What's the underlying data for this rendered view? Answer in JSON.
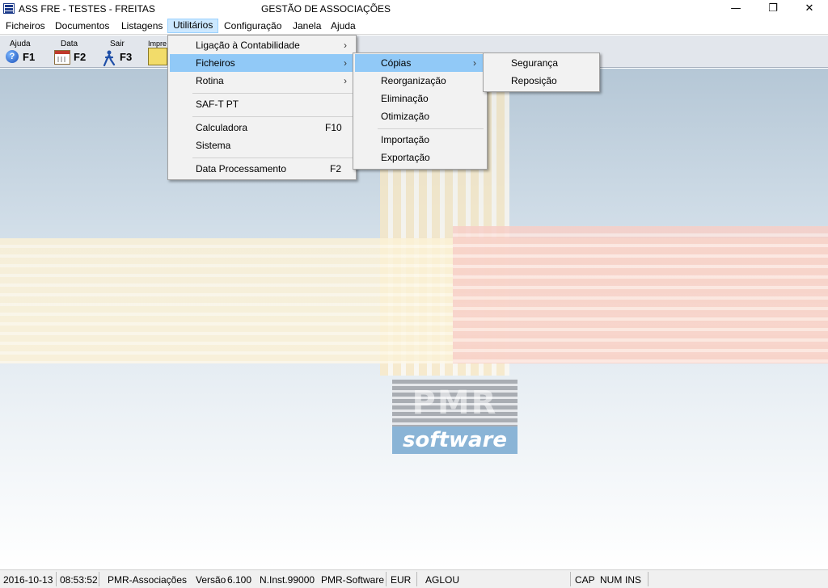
{
  "window": {
    "title_left": "ASS FRE - TESTES - FREITAS",
    "title_center": "GESTÃO DE ASSOCIAÇÕES",
    "min_glyph": "—",
    "max_glyph": "❐",
    "close_glyph": "✕",
    "icon": "pmr-app-icon"
  },
  "menubar": {
    "items": [
      "Ficheiros",
      "Documentos",
      "Listagens",
      "Utilitários",
      "Configuração",
      "Janela",
      "Ajuda"
    ],
    "active": "Utilitários"
  },
  "toolbar": {
    "buttons": [
      {
        "label": "Ajuda",
        "key": "F1",
        "icon": "help-icon"
      },
      {
        "label": "Data",
        "key": "F2",
        "icon": "calendar-icon"
      },
      {
        "label": "Sair",
        "key": "F3",
        "icon": "exit-icon"
      },
      {
        "label": "Impre",
        "key": "",
        "icon": "printer-icon"
      }
    ]
  },
  "menu_utilitarios": {
    "items": [
      {
        "label": "Ligação à Contabilidade",
        "shortcut": "",
        "submenu": true
      },
      {
        "label": "Ficheiros",
        "shortcut": "",
        "submenu": true,
        "highlighted": true
      },
      {
        "label": "Rotina",
        "shortcut": "",
        "submenu": true
      },
      {
        "label": "SAF-T PT",
        "shortcut": ""
      },
      {
        "label": "Calculadora",
        "shortcut": "F10"
      },
      {
        "label": "Sistema",
        "shortcut": ""
      },
      {
        "label": "Data Processamento",
        "shortcut": "F2"
      }
    ],
    "arrow_glyph": "›"
  },
  "menu_ficheiros": {
    "items": [
      {
        "label": "Cópias",
        "submenu": true,
        "highlighted": true
      },
      {
        "label": "Reorganização"
      },
      {
        "label": "Eliminação"
      },
      {
        "label": "Otimização"
      },
      {
        "label": "Importação"
      },
      {
        "label": "Exportação"
      }
    ]
  },
  "menu_copias": {
    "items": [
      {
        "label": "Segurança"
      },
      {
        "label": "Reposição"
      }
    ]
  },
  "logo": {
    "top_text": "PMR",
    "bottom_text": "software"
  },
  "statusbar": {
    "date": "2016-10-13",
    "time": "08:53:52",
    "module": "PMR-Associações",
    "version_label": "Versão",
    "version": "6.100",
    "install": "N.Inst.99000",
    "vendor": "PMR-Software",
    "currency": "EUR",
    "user": "AGLOU",
    "cap": "CAP",
    "num": "NUM",
    "ins": "INS"
  },
  "colors": {
    "menu_highlight": "#91c9f7",
    "menubar_active": "#cce8ff",
    "toolbar_bg": "#e2e6ec"
  }
}
